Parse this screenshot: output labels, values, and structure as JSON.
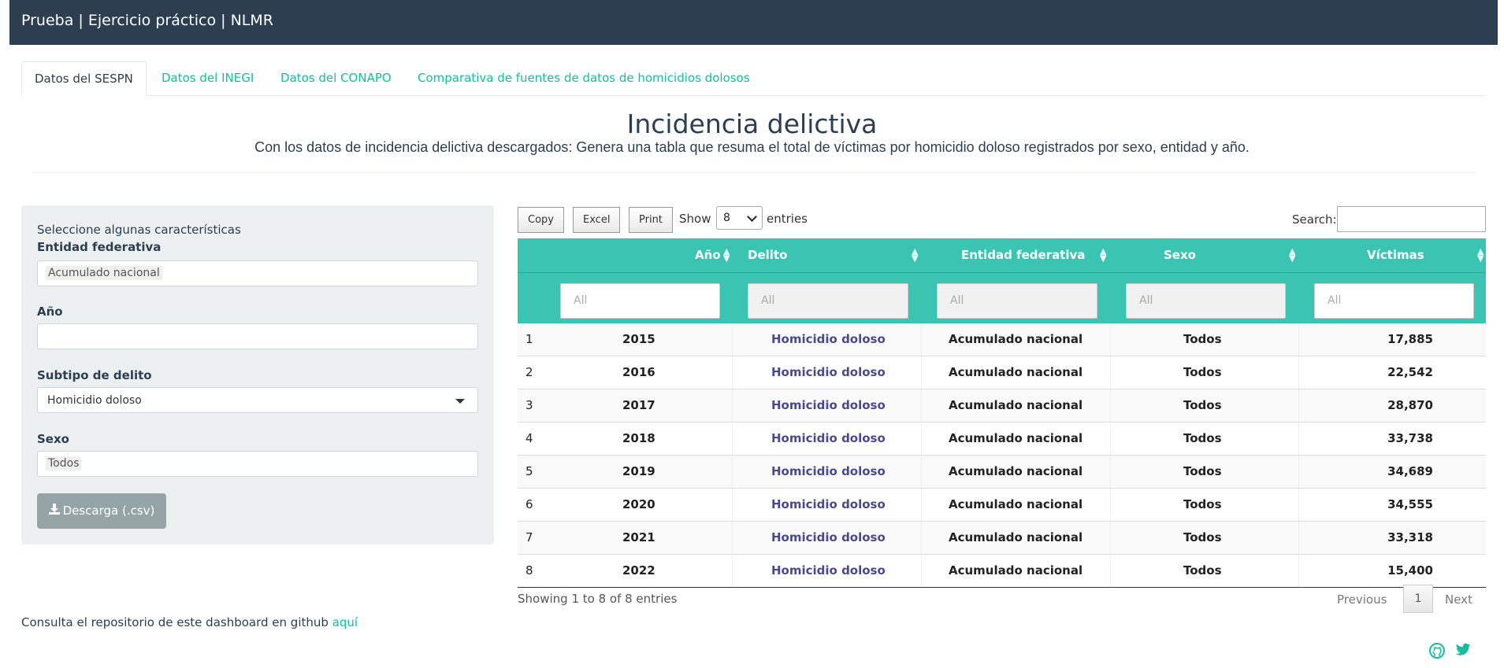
{
  "app": {
    "title": "Prueba | Ejercicio práctico | NLMR"
  },
  "tabs": [
    {
      "label": "Datos del SESPN",
      "active": true
    },
    {
      "label": "Datos del INEGI"
    },
    {
      "label": "Datos del CONAPO"
    },
    {
      "label": "Comparativa de fuentes de datos de homicidios dolosos"
    }
  ],
  "header": {
    "title": "Incidencia delictiva",
    "subtitle": "Con los datos de incidencia delictiva descargados: Genera una tabla que resuma el total de víctimas por homicidio doloso registrados por sexo, entidad y año."
  },
  "sidebar": {
    "hint": "Seleccione algunas características",
    "entidad": {
      "label": "Entidad federativa",
      "value": "Acumulado nacional"
    },
    "anio": {
      "label": "Año",
      "value": ""
    },
    "subtipo": {
      "label": "Subtipo de delito",
      "value": "Homicidio doloso"
    },
    "sexo": {
      "label": "Sexo",
      "value": "Todos"
    },
    "download_label": "Descarga (.csv)"
  },
  "table_controls": {
    "copy": "Copy",
    "excel": "Excel",
    "print": "Print",
    "show": "Show",
    "length": "8",
    "entries": "entries",
    "search_label": "Search:"
  },
  "table": {
    "columns": [
      "Año",
      "Delito",
      "Entidad federativa",
      "Sexo",
      "Víctimas"
    ],
    "filter_placeholder": "All",
    "rows": [
      {
        "n": "1",
        "year": "2015",
        "delito": "Homicidio doloso",
        "entidad": "Acumulado nacional",
        "sexo": "Todos",
        "victimas": "17,885"
      },
      {
        "n": "2",
        "year": "2016",
        "delito": "Homicidio doloso",
        "entidad": "Acumulado nacional",
        "sexo": "Todos",
        "victimas": "22,542"
      },
      {
        "n": "3",
        "year": "2017",
        "delito": "Homicidio doloso",
        "entidad": "Acumulado nacional",
        "sexo": "Todos",
        "victimas": "28,870"
      },
      {
        "n": "4",
        "year": "2018",
        "delito": "Homicidio doloso",
        "entidad": "Acumulado nacional",
        "sexo": "Todos",
        "victimas": "33,738"
      },
      {
        "n": "5",
        "year": "2019",
        "delito": "Homicidio doloso",
        "entidad": "Acumulado nacional",
        "sexo": "Todos",
        "victimas": "34,689"
      },
      {
        "n": "6",
        "year": "2020",
        "delito": "Homicidio doloso",
        "entidad": "Acumulado nacional",
        "sexo": "Todos",
        "victimas": "34,555"
      },
      {
        "n": "7",
        "year": "2021",
        "delito": "Homicidio doloso",
        "entidad": "Acumulado nacional",
        "sexo": "Todos",
        "victimas": "33,318"
      },
      {
        "n": "8",
        "year": "2022",
        "delito": "Homicidio doloso",
        "entidad": "Acumulado nacional",
        "sexo": "Todos",
        "victimas": "15,400"
      }
    ],
    "info": "Showing 1 to 8 of 8 entries",
    "pager": {
      "previous": "Previous",
      "page": "1",
      "next": "Next"
    }
  },
  "footer": {
    "text": "Consulta el repositorio de este dashboard en github ",
    "link": "aquí",
    "icons": [
      "github-icon",
      "twitter-icon"
    ]
  },
  "colors": {
    "navbar": "#2c3e50",
    "accent": "#18bc9c",
    "table_header": "#3cc4b3",
    "sidebar": "#ecf0f1"
  }
}
